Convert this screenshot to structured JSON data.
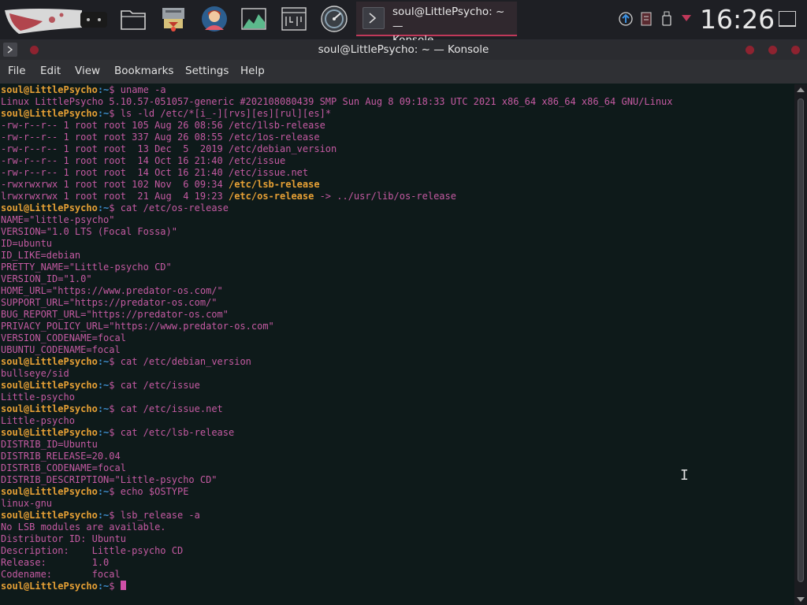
{
  "panel": {
    "launchers": [
      {
        "icon": "knife-launcher-icon"
      },
      {
        "icon": "folder-icon"
      },
      {
        "icon": "package-manager-icon"
      },
      {
        "icon": "user-avatar-icon"
      },
      {
        "icon": "system-monitor-icon"
      },
      {
        "icon": "terminal-grid-icon"
      },
      {
        "icon": "disk-gauge-icon"
      }
    ],
    "task": {
      "title_line1": "soul@LittlePsycho: ~ —",
      "title_line2": "Konsole"
    },
    "clock": "16:26"
  },
  "window": {
    "title": "soul@LittlePsycho: ~ — Konsole"
  },
  "menu": [
    "File",
    "Edit",
    "View",
    "Bookmarks",
    "Settings",
    "Help"
  ],
  "prompt": {
    "user": "soul@LittlePsycho",
    "path": ":~",
    "symbol": "$"
  },
  "terminal": [
    {
      "type": "cmd",
      "text": " uname -a"
    },
    {
      "type": "out",
      "text": "Linux LittlePsycho 5.10.57-051057-generic #202108080439 SMP Sun Aug 8 09:18:33 UTC 2021 x86_64 x86_64 x86_64 GNU/Linux"
    },
    {
      "type": "cmd",
      "text": " ls -ld /etc/*[i_-][rvs][es][rul][es]*"
    },
    {
      "type": "out",
      "text": "-rw-r--r-- 1 root root 105 Aug 26 08:56 /etc/1lsb-release"
    },
    {
      "type": "out",
      "text": "-rw-r--r-- 1 root root 337 Aug 26 08:55 /etc/1os-release"
    },
    {
      "type": "out",
      "text": "-rw-r--r-- 1 root root  13 Dec  5  2019 /etc/debian_version"
    },
    {
      "type": "out",
      "text": "-rw-r--r-- 1 root root  14 Oct 16 21:40 /etc/issue"
    },
    {
      "type": "out",
      "text": "-rw-r--r-- 1 root root  14 Oct 16 21:40 /etc/issue.net"
    },
    {
      "type": "mix",
      "pre": "-rwxrwxrwx 1 root root 102 Nov  6 09:34 ",
      "bold": "/etc/lsb-release",
      "post": ""
    },
    {
      "type": "mix",
      "pre": "lrwxrwxrwx 1 root root  21 Aug  4 19:23 ",
      "bold": "/etc/os-release",
      "post": " -> ../usr/lib/os-release"
    },
    {
      "type": "cmd",
      "text": " cat /etc/os-release"
    },
    {
      "type": "out",
      "text": "NAME=\"little-psycho\""
    },
    {
      "type": "out",
      "text": "VERSION=\"1.0 LTS (Focal Fossa)\""
    },
    {
      "type": "out",
      "text": "ID=ubuntu"
    },
    {
      "type": "out",
      "text": "ID_LIKE=debian"
    },
    {
      "type": "out",
      "text": "PRETTY_NAME=\"Little-psycho CD\""
    },
    {
      "type": "out",
      "text": "VERSION_ID=\"1.0\""
    },
    {
      "type": "out",
      "text": "HOME_URL=\"https://www.predator-os.com/\""
    },
    {
      "type": "out",
      "text": "SUPPORT_URL=\"https://predator-os.com/\""
    },
    {
      "type": "out",
      "text": "BUG_REPORT_URL=\"https://predator-os.com\""
    },
    {
      "type": "out",
      "text": "PRIVACY_POLICY_URL=\"https://www.predator-os.com\""
    },
    {
      "type": "out",
      "text": "VERSION_CODENAME=focal"
    },
    {
      "type": "out",
      "text": "UBUNTU_CODENAME=focal"
    },
    {
      "type": "cmd",
      "text": " cat /etc/debian_version"
    },
    {
      "type": "out",
      "text": "bullseye/sid"
    },
    {
      "type": "cmd",
      "text": " cat /etc/issue"
    },
    {
      "type": "out",
      "text": "Little-psycho"
    },
    {
      "type": "cmd",
      "text": " cat /etc/issue.net"
    },
    {
      "type": "out",
      "text": "Little-psycho"
    },
    {
      "type": "cmd",
      "text": " cat /etc/lsb-release"
    },
    {
      "type": "out",
      "text": "DISTRIB_ID=Ubuntu"
    },
    {
      "type": "out",
      "text": "DISTRIB_RELEASE=20.04"
    },
    {
      "type": "out",
      "text": "DISTRIB_CODENAME=focal"
    },
    {
      "type": "out",
      "text": "DISTRIB_DESCRIPTION=\"Little-psycho CD\""
    },
    {
      "type": "cmd",
      "text": " echo $OSTYPE"
    },
    {
      "type": "out",
      "text": "linux-gnu"
    },
    {
      "type": "cmd",
      "text": " lsb_release -a"
    },
    {
      "type": "out",
      "text": "No LSB modules are available."
    },
    {
      "type": "out",
      "text": "Distributor ID: Ubuntu"
    },
    {
      "type": "out",
      "text": "Description:    Little-psycho CD"
    },
    {
      "type": "out",
      "text": "Release:        1.0"
    },
    {
      "type": "out",
      "text": "Codename:       focal"
    },
    {
      "type": "cursor",
      "text": " "
    }
  ],
  "colors": {
    "prompt_user": "#e6a035",
    "prompt_path": "#3f8fd0",
    "output_text": "#c45aa2",
    "accent": "#c0385a",
    "background": "#0e1a1a"
  }
}
